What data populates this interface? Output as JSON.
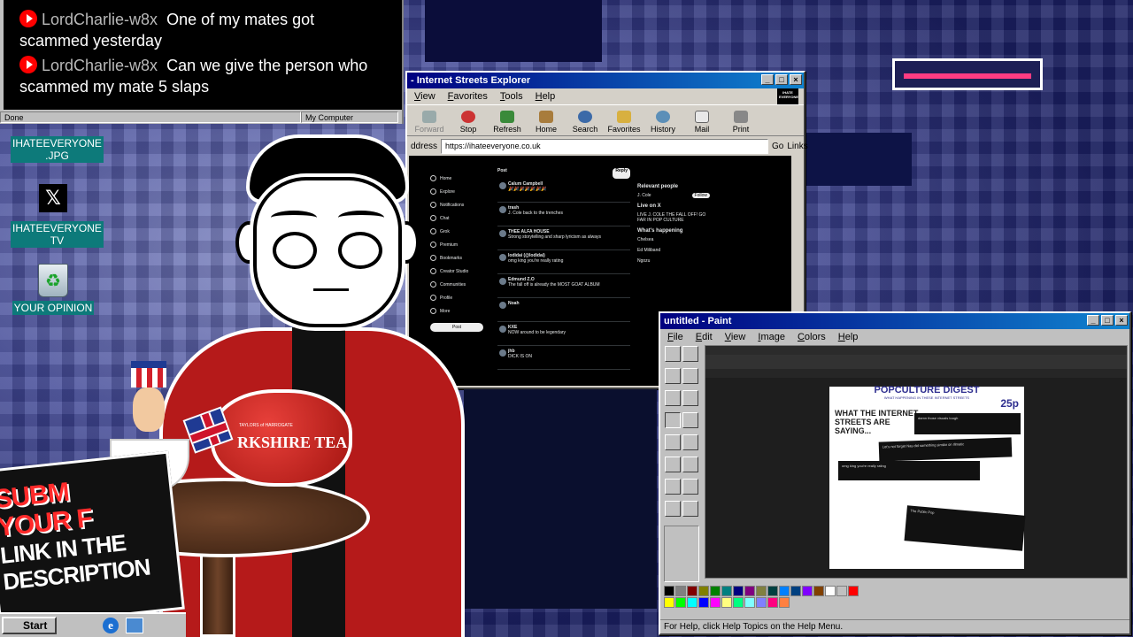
{
  "chat": {
    "top_partial": "",
    "lines": [
      {
        "name": "LordCharlie-w8x",
        "msg": "One of my mates got scammed yesterday"
      },
      {
        "name": "LordCharlie-w8x",
        "msg": "Can we give the person who scammed my mate 5 slaps"
      }
    ],
    "status_done": "Done",
    "status_zone": "My Computer"
  },
  "desktop": {
    "icons": [
      {
        "label": "IHATEEVERYONE .JPG"
      },
      {
        "label": ""
      },
      {
        "label": "IHATEEVERYONE TV"
      },
      {
        "label": "YOUR OPINION"
      }
    ]
  },
  "browser": {
    "title": "- Internet Streets Explorer",
    "menu": [
      "View",
      "Favorites",
      "Tools",
      "Help"
    ],
    "toolbar": [
      "Forward",
      "Stop",
      "Refresh",
      "Home",
      "Search",
      "Favorites",
      "History",
      "Mail",
      "Print"
    ],
    "address_label": "ddress",
    "url": "https://ihateeveryone.co.uk",
    "go": "Go",
    "links": "Links",
    "x_nav": [
      "Home",
      "Explore",
      "Notifications",
      "Chat",
      "Grok",
      "Premium",
      "Bookmarks",
      "Creator Studio",
      "Communities",
      "Profile",
      "More"
    ],
    "x_post_button": "Post",
    "x_header": "Post",
    "x_reply_button": "Reply",
    "x_feed": [
      {
        "author": "Calum Campbell",
        "text": "🎉🎉🎉🎉🎉🎉🎉"
      },
      {
        "author": "trash",
        "text": "J. Cole back to the trenches"
      },
      {
        "author": "THEE ALFA HOUSE",
        "text": "Strong storytelling and sharp lyricism as always"
      },
      {
        "author": "lodidai (@lodidai)",
        "text": "omg king you're really rating"
      },
      {
        "author": "Edmund Z.O",
        "text": "The fall off is already the MOST GOAT ALBUM"
      },
      {
        "author": "Noah",
        "text": ""
      },
      {
        "author": "KXE",
        "text": "NOW around to be legendary"
      },
      {
        "author": "jhb",
        "text": "DICK IS ON"
      }
    ],
    "x_relevant_title": "Relevant people",
    "x_relevant_name": "J. Cole",
    "x_follow": "Follow",
    "x_live_title": "Live on X",
    "x_live_text": "LIVE J. COLE THE FALL OFF! GO FAR IN POP CULTURE",
    "x_happening_title": "What's happening",
    "x_happening": [
      "Chelsea",
      "Ed Miliband",
      "Ngozu"
    ]
  },
  "paint": {
    "title": "untitled - Paint",
    "menu": [
      "File",
      "Edit",
      "View",
      "Image",
      "Colors",
      "Help"
    ],
    "status": "For Help, click Help Topics on the Help Menu.",
    "doc_title": "POPCULTURE DIGEST",
    "doc_subtitle": "WHAT HAPPENING IN THESE INTERNET STREETS",
    "doc_price": "25p",
    "doc_heading": "WHAT THE INTERNET STREETS ARE SAYING...",
    "cards": [
      "damn those visuals tough",
      "Let's not forget Nas did something similar on Illmatic",
      "omg king you're really rating",
      "The Public Pop"
    ],
    "colors": [
      "#000000",
      "#808080",
      "#800000",
      "#808000",
      "#008000",
      "#008080",
      "#000080",
      "#800080",
      "#808040",
      "#004040",
      "#0080ff",
      "#004080",
      "#8000ff",
      "#804000",
      "#ffffff",
      "#c0c0c0",
      "#ff0000",
      "#ffff00",
      "#00ff00",
      "#00ffff",
      "#0000ff",
      "#ff00ff",
      "#ffff80",
      "#00ff80",
      "#80ffff",
      "#8080ff",
      "#ff0080",
      "#ff8040"
    ]
  },
  "overlay": {
    "submit_lines": [
      "SUBM",
      "YOUR F",
      "LINK IN THE",
      "DESCRIPTION"
    ],
    "teapot_label": "RKSHIRE TEA",
    "teapot_small": "TAYLORS of HARROGATE"
  },
  "taskbar": {
    "start": "Start"
  }
}
